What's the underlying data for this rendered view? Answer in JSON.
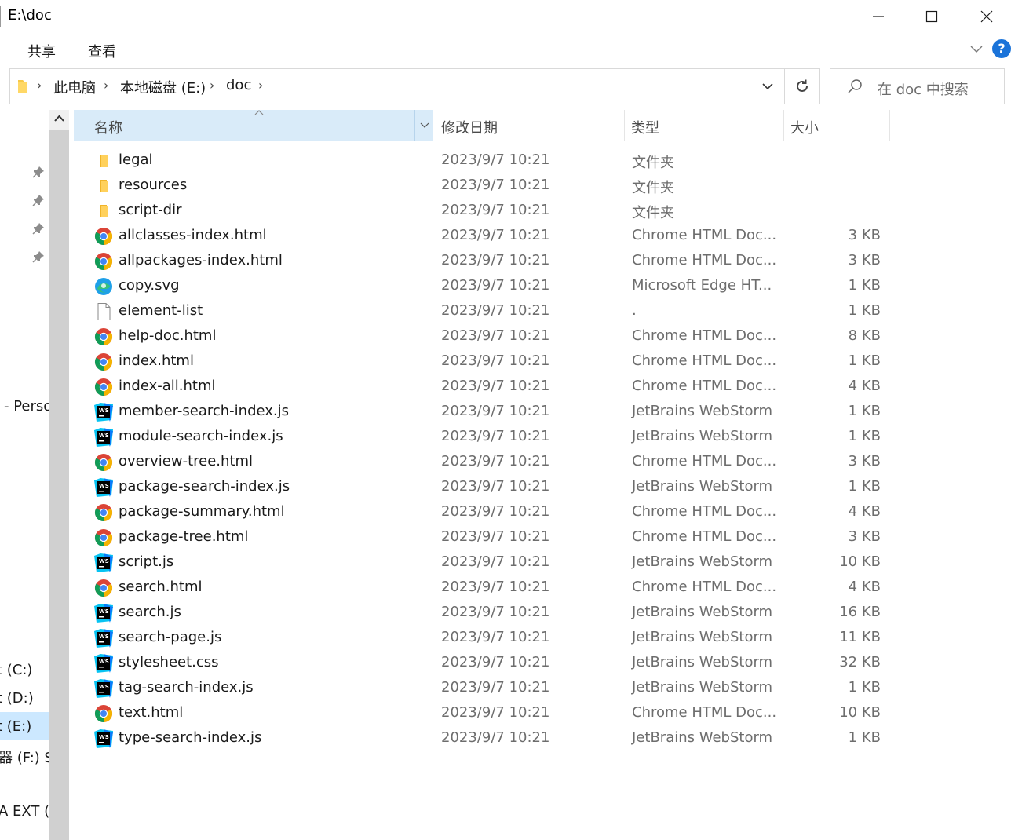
{
  "window": {
    "title": "E:\\doc"
  },
  "ribbon": {
    "tabs": [
      "共享",
      "查看"
    ],
    "help_label": "?"
  },
  "address": {
    "crumbs": [
      "此电脑",
      "本地磁盘 (E:)",
      "doc"
    ]
  },
  "search": {
    "placeholder": "在 doc 中搜索"
  },
  "nav": {
    "items": [
      "- Perso",
      "t (C:)",
      "t (D:)",
      "t (E:)",
      "器 (F:) S",
      "A EXT ("
    ]
  },
  "columns": {
    "name": "名称",
    "date": "修改日期",
    "type": "类型",
    "size": "大小"
  },
  "files": [
    {
      "name": "legal",
      "date": "2023/9/7 10:21",
      "type": "文件夹",
      "size": "",
      "icon": "folder"
    },
    {
      "name": "resources",
      "date": "2023/9/7 10:21",
      "type": "文件夹",
      "size": "",
      "icon": "folder"
    },
    {
      "name": "script-dir",
      "date": "2023/9/7 10:21",
      "type": "文件夹",
      "size": "",
      "icon": "folder"
    },
    {
      "name": "allclasses-index.html",
      "date": "2023/9/7 10:21",
      "type": "Chrome HTML Doc...",
      "size": "3 KB",
      "icon": "chrome"
    },
    {
      "name": "allpackages-index.html",
      "date": "2023/9/7 10:21",
      "type": "Chrome HTML Doc...",
      "size": "3 KB",
      "icon": "chrome"
    },
    {
      "name": "copy.svg",
      "date": "2023/9/7 10:21",
      "type": "Microsoft Edge HT...",
      "size": "1 KB",
      "icon": "edge"
    },
    {
      "name": "element-list",
      "date": "2023/9/7 10:21",
      "type": ".",
      "size": "1 KB",
      "icon": "blank"
    },
    {
      "name": "help-doc.html",
      "date": "2023/9/7 10:21",
      "type": "Chrome HTML Doc...",
      "size": "8 KB",
      "icon": "chrome"
    },
    {
      "name": "index.html",
      "date": "2023/9/7 10:21",
      "type": "Chrome HTML Doc...",
      "size": "1 KB",
      "icon": "chrome"
    },
    {
      "name": "index-all.html",
      "date": "2023/9/7 10:21",
      "type": "Chrome HTML Doc...",
      "size": "4 KB",
      "icon": "chrome"
    },
    {
      "name": "member-search-index.js",
      "date": "2023/9/7 10:21",
      "type": "JetBrains WebStorm",
      "size": "1 KB",
      "icon": "webstorm"
    },
    {
      "name": "module-search-index.js",
      "date": "2023/9/7 10:21",
      "type": "JetBrains WebStorm",
      "size": "1 KB",
      "icon": "webstorm"
    },
    {
      "name": "overview-tree.html",
      "date": "2023/9/7 10:21",
      "type": "Chrome HTML Doc...",
      "size": "3 KB",
      "icon": "chrome"
    },
    {
      "name": "package-search-index.js",
      "date": "2023/9/7 10:21",
      "type": "JetBrains WebStorm",
      "size": "1 KB",
      "icon": "webstorm"
    },
    {
      "name": "package-summary.html",
      "date": "2023/9/7 10:21",
      "type": "Chrome HTML Doc...",
      "size": "4 KB",
      "icon": "chrome"
    },
    {
      "name": "package-tree.html",
      "date": "2023/9/7 10:21",
      "type": "Chrome HTML Doc...",
      "size": "3 KB",
      "icon": "chrome"
    },
    {
      "name": "script.js",
      "date": "2023/9/7 10:21",
      "type": "JetBrains WebStorm",
      "size": "10 KB",
      "icon": "webstorm"
    },
    {
      "name": "search.html",
      "date": "2023/9/7 10:21",
      "type": "Chrome HTML Doc...",
      "size": "4 KB",
      "icon": "chrome"
    },
    {
      "name": "search.js",
      "date": "2023/9/7 10:21",
      "type": "JetBrains WebStorm",
      "size": "16 KB",
      "icon": "webstorm"
    },
    {
      "name": "search-page.js",
      "date": "2023/9/7 10:21",
      "type": "JetBrains WebStorm",
      "size": "11 KB",
      "icon": "webstorm"
    },
    {
      "name": "stylesheet.css",
      "date": "2023/9/7 10:21",
      "type": "JetBrains WebStorm",
      "size": "32 KB",
      "icon": "webstorm"
    },
    {
      "name": "tag-search-index.js",
      "date": "2023/9/7 10:21",
      "type": "JetBrains WebStorm",
      "size": "1 KB",
      "icon": "webstorm"
    },
    {
      "name": "text.html",
      "date": "2023/9/7 10:21",
      "type": "Chrome HTML Doc...",
      "size": "10 KB",
      "icon": "chrome"
    },
    {
      "name": "type-search-index.js",
      "date": "2023/9/7 10:21",
      "type": "JetBrains WebStorm",
      "size": "1 KB",
      "icon": "webstorm"
    }
  ],
  "colors": {
    "selection": "#cce8ff",
    "header_sorted": "#d9ebf9",
    "accent": "#1a73d9"
  }
}
